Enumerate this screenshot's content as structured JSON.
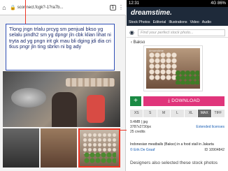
{
  "browser": {
    "url": "sconnect.fcgk?-1?ra7b..."
  },
  "note": {
    "text": "Tlong jngn trlalu prcyg sm penjual bkso yg selalu pindh2 sm yg dpngr jln cbk klian lihat ni tryta ad yg pngn irit gk mau bli dging jdi dia cri tkus pngr jln ting sbrkn ni bg ady"
  },
  "site": {
    "status_left": "12:31",
    "status_right": "4G 86%",
    "logo": "dreamstime.",
    "tabs": [
      "Stock Photos",
      "Editorial",
      "Illustrations",
      "Video",
      "Audio"
    ],
    "search_placeholder": "Find your perfect stock photo...",
    "breadcrumb": "Bakso",
    "watermark": "dreamstime",
    "download_label": "DOWNLOAD",
    "plus_label": "+",
    "sizes": [
      "XS",
      "S",
      "M",
      "L",
      "XL",
      "MAX",
      "TIFF"
    ],
    "selected_size": "MAX",
    "file_info_1": "9.4MB | jpg",
    "file_info_2": "3787x2730px",
    "extended": "Extended licenses",
    "credits_line": "25 credits",
    "description": "Indonesian meatballs (Bakso) in a food stall in Jakarta",
    "author": "Erik De Graaf",
    "id_text": "ID 10904842",
    "also": "Designers also selected these stock photos"
  },
  "colors": {
    "accent_pink": "#e0357b",
    "accent_green": "#1a8a44",
    "header_navy": "#1e2a3a",
    "note_border": "#2f4fb6",
    "highlight_red": "#ee3322"
  }
}
